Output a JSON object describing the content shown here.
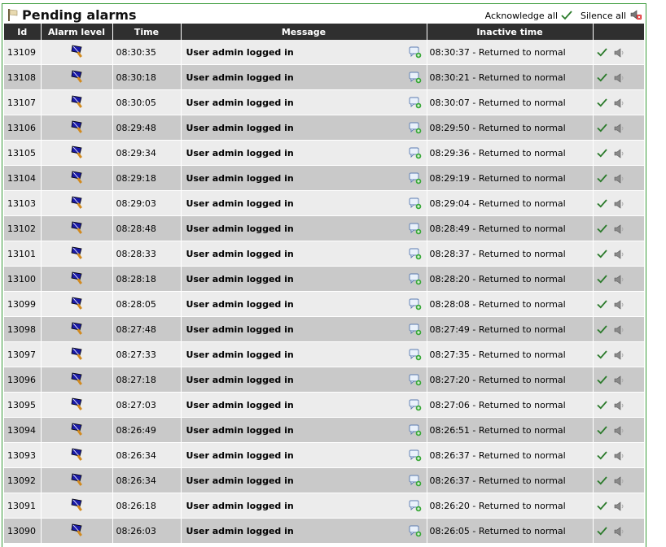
{
  "header": {
    "title": "Pending alarms",
    "acknowledge_all": "Acknowledge all",
    "silence_all": "Silence all"
  },
  "columns": [
    "Id",
    "Alarm level",
    "Time",
    "Message",
    "Inactive time",
    ""
  ],
  "icons": {
    "title": "flag-icon",
    "level": "alarm-flag-icon",
    "note": "add-comment-icon",
    "ack": "check-icon",
    "silence": "speaker-mute-icon"
  },
  "colors": {
    "header_bg": "#2f2f2f",
    "row_light": "#ececec",
    "row_dark": "#c9c9c9",
    "border": "#3a9a3a",
    "ack": "#2a7a2a"
  },
  "rows": [
    {
      "id": "13109",
      "time": "08:30:35",
      "message": "User admin logged in",
      "inactive": "08:30:37 - Returned to normal"
    },
    {
      "id": "13108",
      "time": "08:30:18",
      "message": "User admin logged in",
      "inactive": "08:30:21 - Returned to normal"
    },
    {
      "id": "13107",
      "time": "08:30:05",
      "message": "User admin logged in",
      "inactive": "08:30:07 - Returned to normal"
    },
    {
      "id": "13106",
      "time": "08:29:48",
      "message": "User admin logged in",
      "inactive": "08:29:50 - Returned to normal"
    },
    {
      "id": "13105",
      "time": "08:29:34",
      "message": "User admin logged in",
      "inactive": "08:29:36 - Returned to normal"
    },
    {
      "id": "13104",
      "time": "08:29:18",
      "message": "User admin logged in",
      "inactive": "08:29:19 - Returned to normal"
    },
    {
      "id": "13103",
      "time": "08:29:03",
      "message": "User admin logged in",
      "inactive": "08:29:04 - Returned to normal"
    },
    {
      "id": "13102",
      "time": "08:28:48",
      "message": "User admin logged in",
      "inactive": "08:28:49 - Returned to normal"
    },
    {
      "id": "13101",
      "time": "08:28:33",
      "message": "User admin logged in",
      "inactive": "08:28:37 - Returned to normal"
    },
    {
      "id": "13100",
      "time": "08:28:18",
      "message": "User admin logged in",
      "inactive": "08:28:20 - Returned to normal"
    },
    {
      "id": "13099",
      "time": "08:28:05",
      "message": "User admin logged in",
      "inactive": "08:28:08 - Returned to normal"
    },
    {
      "id": "13098",
      "time": "08:27:48",
      "message": "User admin logged in",
      "inactive": "08:27:49 - Returned to normal"
    },
    {
      "id": "13097",
      "time": "08:27:33",
      "message": "User admin logged in",
      "inactive": "08:27:35 - Returned to normal"
    },
    {
      "id": "13096",
      "time": "08:27:18",
      "message": "User admin logged in",
      "inactive": "08:27:20 - Returned to normal"
    },
    {
      "id": "13095",
      "time": "08:27:03",
      "message": "User admin logged in",
      "inactive": "08:27:06 - Returned to normal"
    },
    {
      "id": "13094",
      "time": "08:26:49",
      "message": "User admin logged in",
      "inactive": "08:26:51 - Returned to normal"
    },
    {
      "id": "13093",
      "time": "08:26:34",
      "message": "User admin logged in",
      "inactive": "08:26:37 - Returned to normal"
    },
    {
      "id": "13092",
      "time": "08:26:34",
      "message": "User admin logged in",
      "inactive": "08:26:37 - Returned to normal"
    },
    {
      "id": "13091",
      "time": "08:26:18",
      "message": "User admin logged in",
      "inactive": "08:26:20 - Returned to normal"
    },
    {
      "id": "13090",
      "time": "08:26:03",
      "message": "User admin logged in",
      "inactive": "08:26:05 - Returned to normal"
    }
  ]
}
